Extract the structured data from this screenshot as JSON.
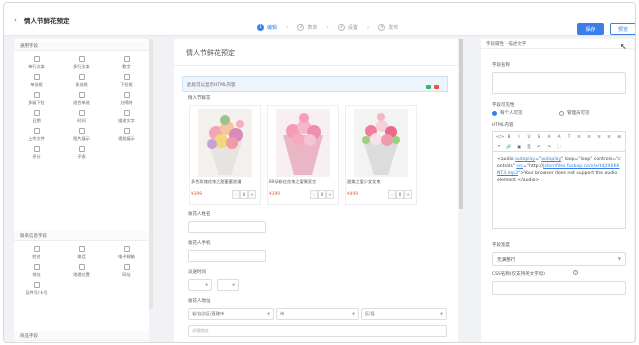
{
  "header": {
    "back_icon": "chevron-left-icon",
    "title": "情人节鲜花预定",
    "steps": [
      {
        "num": "1",
        "label": "编辑",
        "active": true
      },
      {
        "num": "2",
        "label": "表单",
        "active": false
      },
      {
        "num": "3",
        "label": "设置",
        "active": false
      },
      {
        "num": "4",
        "label": "发布",
        "active": false
      }
    ],
    "save_label": "保存",
    "preview_label": "预览"
  },
  "palette": {
    "common_title": "通用字段",
    "common_fields": [
      "单行文本",
      "多行文本",
      "数字",
      "单选框",
      "多选框",
      "下拉框",
      "多级下拉",
      "组合单选",
      "分隔符",
      "日期",
      "时间",
      "描述文字",
      "上传文件",
      "图片展示",
      "视频展示",
      "评分",
      "子表"
    ],
    "contact_title": "联系信息字段",
    "contact_fields": [
      "姓名",
      "电话",
      "电子邮箱",
      "地址",
      "地理位置",
      "网址",
      "证件号/卡号"
    ],
    "more_title": "商品字段"
  },
  "canvas": {
    "title": "情人节鲜花预定",
    "html_placeholder": "此处可以显示HTML内容",
    "product_label": "情人节鲜花",
    "products": [
      {
        "name": "多色玫瑰花束之甜蜜蜜浪漫",
        "price": "¥399",
        "qty": "0"
      },
      {
        "name": "80朵粉红花束之爱情宣言",
        "price": "¥399",
        "qty": "0"
      },
      {
        "name": "甜美之爱少女花束",
        "price": "¥499",
        "qty": "0"
      }
    ],
    "recipient_name_label": "收花人姓名",
    "recipient_phone_label": "收花人手机",
    "delivery_time_label": "派送时间",
    "address_label": "收花人地址",
    "province_placeholder": "省/自治区/直辖市",
    "city_placeholder": "市",
    "district_placeholder": "区/县",
    "detail_placeholder": "详细地址"
  },
  "props": {
    "tab_label": "字段属性 · 描述文字",
    "field_name_label": "字段名称",
    "visibility_label": "字段可见性",
    "visibility_options": [
      {
        "label": "每个人可见",
        "checked": true
      },
      {
        "label": "管理员可见",
        "checked": false
      }
    ],
    "html_content_label": "HTML内容",
    "toolbar_icons": [
      "</>",
      "B",
      "I",
      "U",
      "S",
      "A",
      "A",
      "T",
      "≡",
      "≡",
      "≡",
      "≡",
      "⊞",
      "❝",
      "🔗",
      "▣",
      "⎘",
      "↶",
      "↷",
      "⛶"
    ],
    "html_code": {
      "p1": "<audio ",
      "attr1": "autoplay",
      "p2": "=\"",
      "attr2": "autoplay",
      "p3": "\" loop=\"loop\" controls=\"controls\" ",
      "attr3": "src",
      "p4": "=\"http://",
      "attr4": "jsfornfiles.fxsbop.com/xrtdjtX6KKNT3.mp3",
      "p5": "\">Your browser does not support the audio element.</audio>"
    },
    "width_label": "字段宽度",
    "width_value": "无满整行",
    "css_label": "CSS名称(仅支持英文字母)"
  },
  "colors": {
    "accent": "#3a7ee8",
    "price": "#e05a3a",
    "ctrl_green": "#3db374",
    "ctrl_red": "#e05a3a"
  }
}
